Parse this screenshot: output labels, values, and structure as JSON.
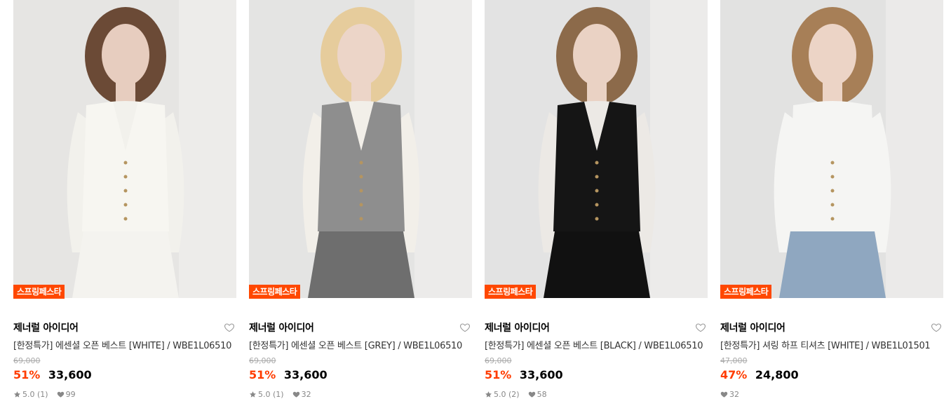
{
  "products": [
    {
      "badge": "스프링페스타",
      "brand": "제너럴 아이디어",
      "title": "[한정특가] 에센셜 오픈 베스트 [WHITE] / WBE1L06510",
      "original_price": "69,000",
      "discount": "51%",
      "price": "33,600",
      "rating": "5.0 (1)",
      "likes": "99",
      "image_colors": {
        "bg": "#e6e5e3",
        "top": "#f7f6f1",
        "under": "#f2f1ec",
        "skin": "#e7cdbf",
        "hair": "#6b4a36",
        "bottom": "#f4f3ef"
      }
    },
    {
      "badge": "스프링페스타",
      "brand": "제너럴 아이디어",
      "title": "[한정특가] 에센셜 오픈 베스트 [GREY] / WBE1L06510",
      "original_price": "69,000",
      "discount": "51%",
      "price": "33,600",
      "rating": "5.0 (1)",
      "likes": "32",
      "image_colors": {
        "bg": "#e4e4e3",
        "top": "#8e8e8e",
        "under": "#f2efe9",
        "skin": "#ecd5c8",
        "hair": "#e6cc9c",
        "bottom": "#6e6e6e"
      }
    },
    {
      "badge": "스프링페스타",
      "brand": "제너럴 아이디어",
      "title": "[한정특가] 에센셜 오픈 베스트 [BLACK] / WBE1L06510",
      "original_price": "69,000",
      "discount": "51%",
      "price": "33,600",
      "rating": "5.0 (2)",
      "likes": "58",
      "image_colors": {
        "bg": "#e3e3e3",
        "top": "#151515",
        "under": "#ece9e5",
        "skin": "#ead2c4",
        "hair": "#8c6a4a",
        "bottom": "#111111"
      }
    },
    {
      "badge": "스프링페스타",
      "brand": "제너럴 아이디어",
      "title": "[한정특가] 셔링 하프 티셔츠 [WHITE] / WBE1L01501",
      "original_price": "47,000",
      "discount": "47%",
      "price": "24,800",
      "rating": "",
      "likes": "32",
      "image_colors": {
        "bg": "#e2e2e1",
        "top": "#f5f5f3",
        "under": "#f5f5f3",
        "skin": "#ecd4c6",
        "hair": "#a77f57",
        "bottom": "#8fa7c0"
      }
    }
  ]
}
